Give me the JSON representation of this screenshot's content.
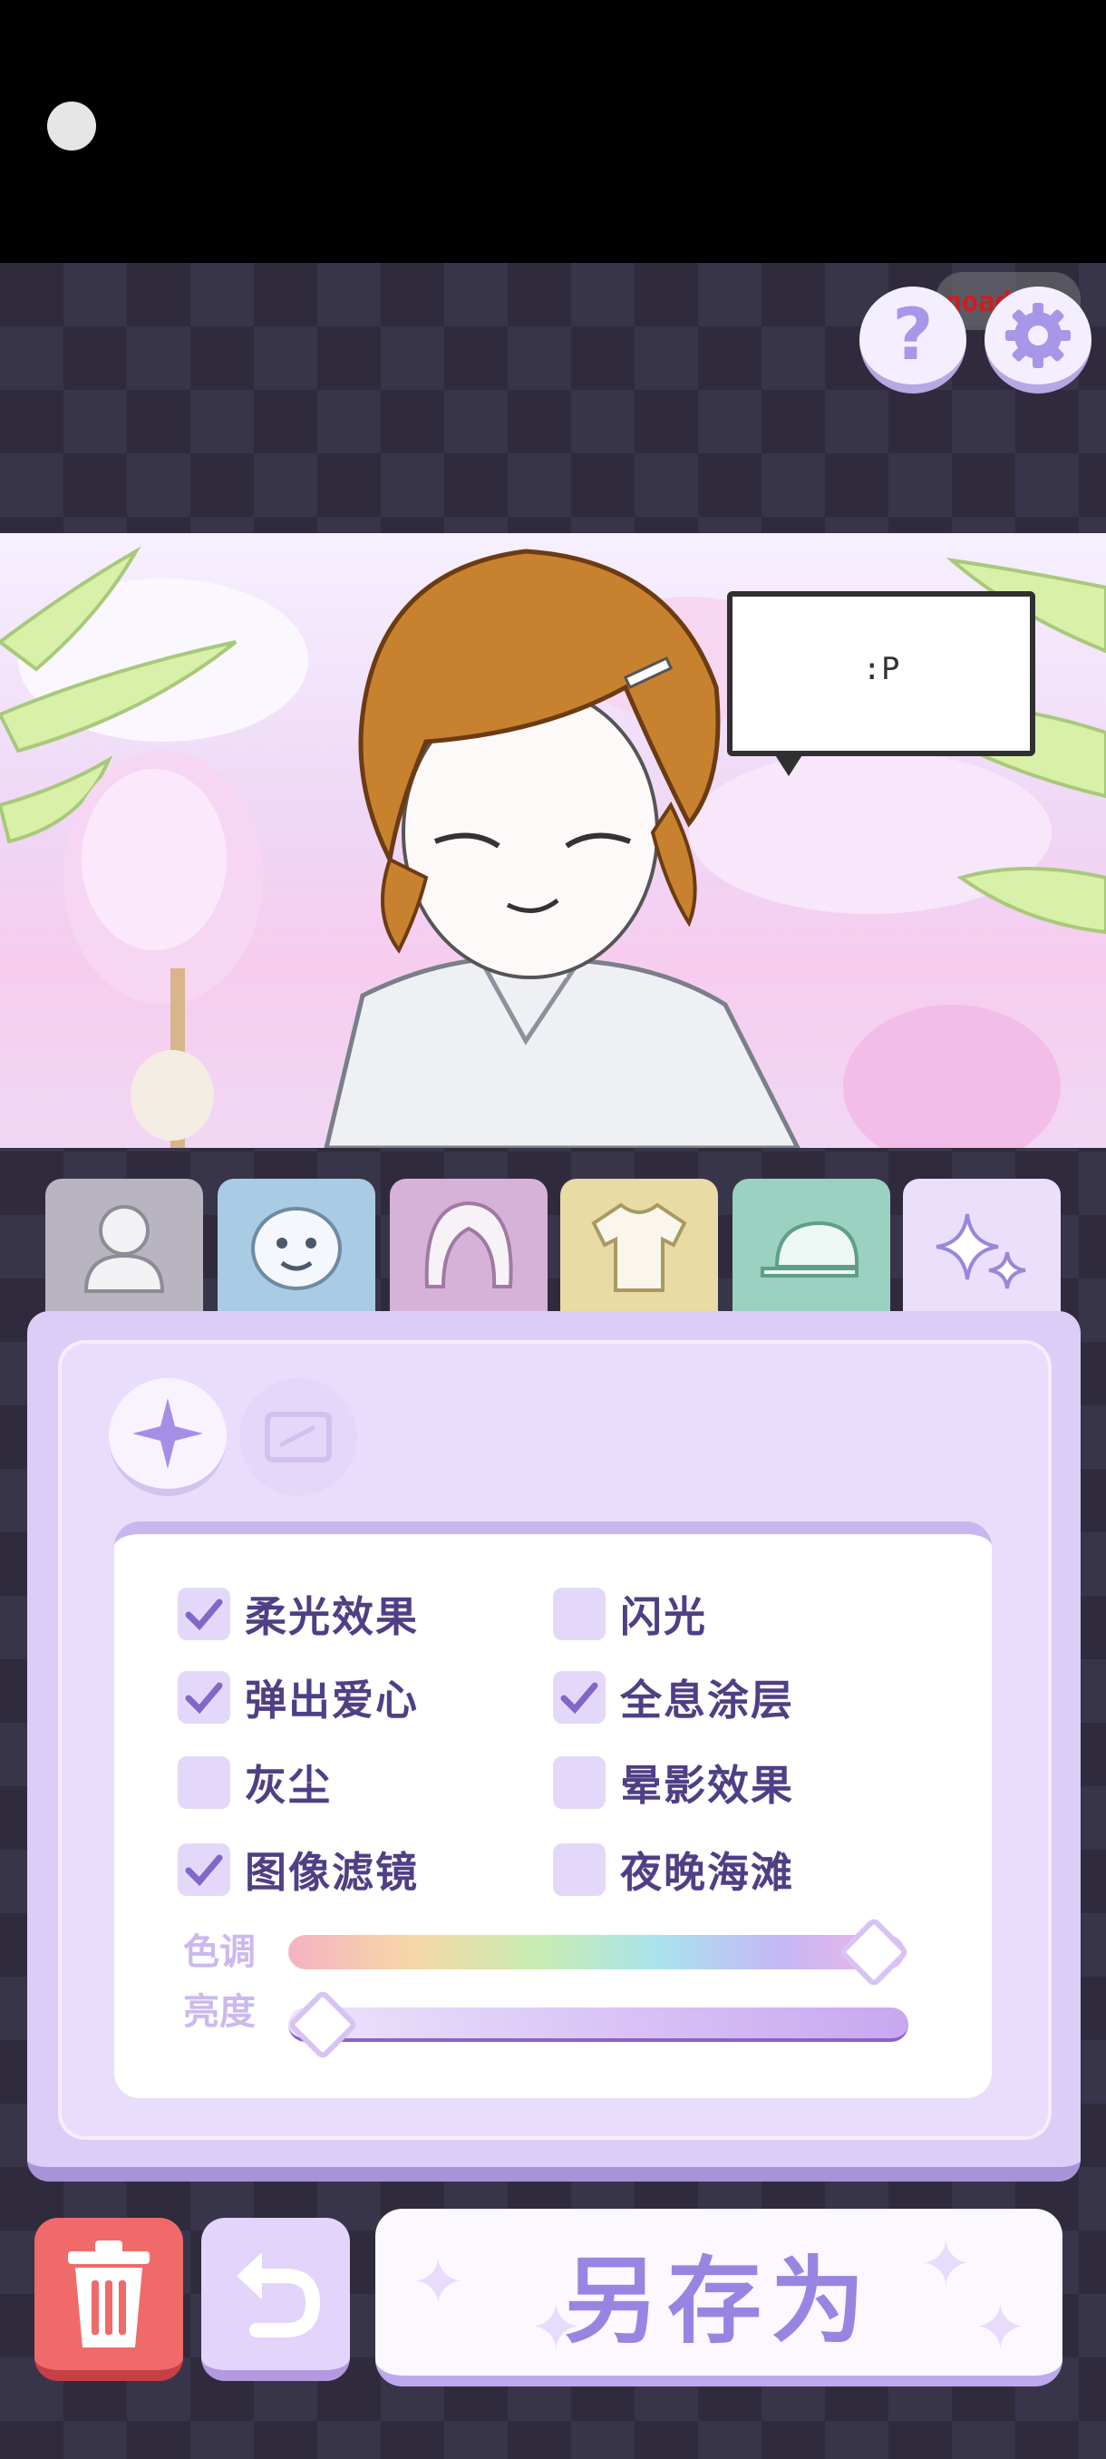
{
  "top_right": {
    "noads_label": "noads",
    "close_label": "×",
    "help_label": "?"
  },
  "preview": {
    "speech_bubble_text": ":P"
  },
  "category_tabs": [
    "body",
    "face",
    "hair",
    "clothing",
    "hat",
    "effects"
  ],
  "effects_panel": {
    "options": [
      {
        "label": "柔光效果",
        "checked": true
      },
      {
        "label": "闪光",
        "checked": false
      },
      {
        "label": "弹出爱心",
        "checked": true
      },
      {
        "label": "全息涂层",
        "checked": true
      },
      {
        "label": "灰尘",
        "checked": false
      },
      {
        "label": "晕影效果",
        "checked": false
      },
      {
        "label": "图像滤镜",
        "checked": true
      },
      {
        "label": "夜晚海滩",
        "checked": false
      }
    ],
    "hue": {
      "label": "色调",
      "value": 0.97
    },
    "brightness": {
      "label": "亮度",
      "value": 0.04
    }
  },
  "bottom_bar": {
    "save_as_label": "另存为"
  },
  "icons": [
    "camera-dot",
    "help-icon",
    "gear-icon",
    "person-icon",
    "face-icon",
    "hair-icon",
    "shirt-icon",
    "cap-icon",
    "sparkle-icon",
    "frame-icon",
    "trash-icon",
    "undo-icon"
  ],
  "colors": {
    "accent_purple": "#9a84e2",
    "label_text": "#4f3f85",
    "checkbox_fill": "#e4d8fa",
    "trash_red": "#f06a6a"
  }
}
